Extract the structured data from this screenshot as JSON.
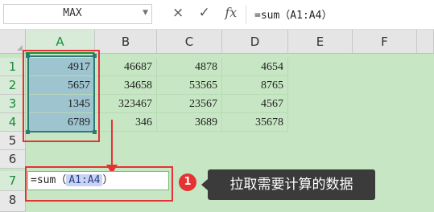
{
  "formula_bar": {
    "name_box": "MAX",
    "cancel_icon": "×",
    "confirm_icon": "✓",
    "fx_label": "fx",
    "formula": "=sum（A1:A4）"
  },
  "columns": [
    "A",
    "B",
    "C",
    "D",
    "E",
    "F"
  ],
  "rows": [
    "1",
    "2",
    "3",
    "4",
    "5",
    "6",
    "7",
    "8"
  ],
  "cells": [
    [
      "4917",
      "46687",
      "4878",
      "4654"
    ],
    [
      "5657",
      "34658",
      "53565",
      "8765"
    ],
    [
      "1345",
      "323467",
      "23567",
      "4567"
    ],
    [
      "6789",
      "346",
      "3689",
      "35678"
    ]
  ],
  "edit_cell": {
    "prefix": "=sum（",
    "ref": "A1:A4",
    "suffix": "）"
  },
  "annotation": {
    "step": "1",
    "text": "拉取需要计算的数据"
  },
  "colors": {
    "grid_bg": "#c7e7c4",
    "selection": "#9dc4cf",
    "highlight_red": "#e53333",
    "callout_bg": "#3b3b3b"
  }
}
